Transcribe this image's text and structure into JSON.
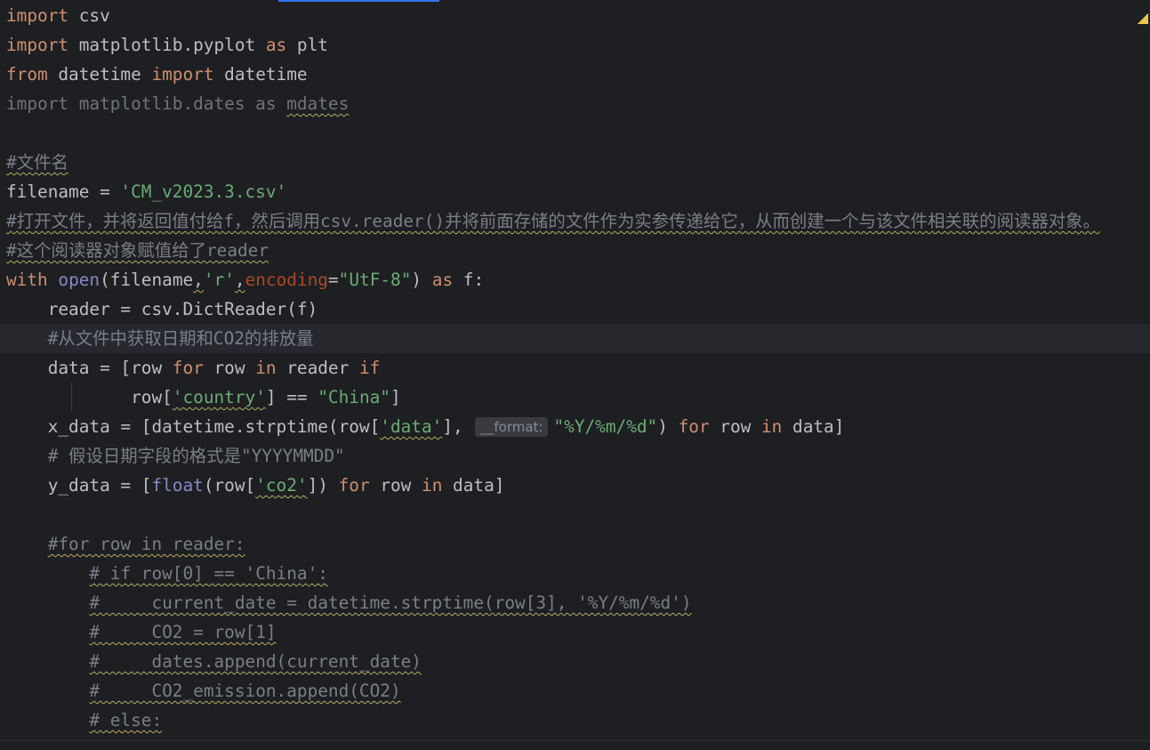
{
  "editor": {
    "language": "python",
    "current_line_index": 11,
    "inspection_widget_icon": "warning-triangle-icon",
    "parameter_hint": "__format:",
    "colors": {
      "background": "#1e1f22",
      "keyword": "#cf8e6d",
      "string": "#6aab73",
      "builtin": "#8888c6",
      "parameter": "#aa4926",
      "comment": "#7a7e85",
      "accent": "#3574f0",
      "warning_underline": "#b3ae60"
    }
  },
  "lines": [
    [
      {
        "t": "import",
        "c": "kw"
      },
      {
        "t": " csv"
      }
    ],
    [
      {
        "t": "import",
        "c": "kw"
      },
      {
        "t": " matplotlib.pyplot "
      },
      {
        "t": "as",
        "c": "kw"
      },
      {
        "t": " plt"
      }
    ],
    [
      {
        "t": "from",
        "c": "kw"
      },
      {
        "t": " datetime "
      },
      {
        "t": "import",
        "c": "kw"
      },
      {
        "t": " datetime"
      }
    ],
    [
      {
        "t": "import matplotlib.dates as ",
        "c": "unused"
      },
      {
        "t": "mdates",
        "c": "unused wavy"
      }
    ],
    [],
    [
      {
        "t": "#文件名",
        "c": "cmt wavy"
      }
    ],
    [
      {
        "t": "filename = "
      },
      {
        "t": "'CM_v2023.3.csv'",
        "c": "str"
      }
    ],
    [
      {
        "t": "#打开文件，并将返回值付给f，然后调用csv.reader()并将前面存储的文件作为实参传递给它，从而创建一个与该文件相关联的阅读器对象。",
        "c": "cmt wavy"
      }
    ],
    [
      {
        "t": "#这个阅读器对象赋值给了reader",
        "c": "cmt wavy"
      }
    ],
    [
      {
        "t": "with",
        "c": "kw"
      },
      {
        "t": " "
      },
      {
        "t": "open",
        "c": "bi"
      },
      {
        "t": "(filename"
      },
      {
        "t": ",",
        "c": "wavy"
      },
      {
        "t": "'r'",
        "c": "str"
      },
      {
        "t": ",",
        "c": "wavy"
      },
      {
        "t": "encoding",
        "c": "par"
      },
      {
        "t": "="
      },
      {
        "t": "\"UtF-8\"",
        "c": "str"
      },
      {
        "t": ") "
      },
      {
        "t": "as",
        "c": "kw"
      },
      {
        "t": " f:"
      }
    ],
    [
      {
        "t": "    reader = csv.DictReader(f)"
      }
    ],
    [
      {
        "t": "    "
      },
      {
        "t": "#从文件中获取日期和CO2的排放量",
        "c": "cmt"
      }
    ],
    [
      {
        "t": "    data = [row "
      },
      {
        "t": "for",
        "c": "kw"
      },
      {
        "t": " row "
      },
      {
        "t": "in",
        "c": "kw"
      },
      {
        "t": " reader "
      },
      {
        "t": "if",
        "c": "kw"
      }
    ],
    [
      {
        "t": "            row["
      },
      {
        "t": "'country'",
        "c": "str wavy"
      },
      {
        "t": "] == "
      },
      {
        "t": "\"China\"",
        "c": "str"
      },
      {
        "t": "]"
      }
    ],
    [
      {
        "t": "    x_data = [datetime.strptime(row["
      },
      {
        "t": "'data'",
        "c": "str wavy"
      },
      {
        "t": "], "
      },
      {
        "hint": true
      },
      {
        "t": "\"%Y/%m/%d\"",
        "c": "str"
      },
      {
        "t": ") "
      },
      {
        "t": "for",
        "c": "kw"
      },
      {
        "t": " row "
      },
      {
        "t": "in",
        "c": "kw"
      },
      {
        "t": " data]"
      }
    ],
    [
      {
        "t": "    "
      },
      {
        "t": "# 假设日期字段的格式是\"YYYYMMDD\"",
        "c": "cmt"
      }
    ],
    [
      {
        "t": "    y_data = ["
      },
      {
        "t": "float",
        "c": "bi"
      },
      {
        "t": "(row["
      },
      {
        "t": "'co2'",
        "c": "str wavy"
      },
      {
        "t": "]) "
      },
      {
        "t": "for",
        "c": "kw"
      },
      {
        "t": " row "
      },
      {
        "t": "in",
        "c": "kw"
      },
      {
        "t": " data]"
      }
    ],
    [],
    [
      {
        "t": "    "
      },
      {
        "t": "#for row in reader:",
        "c": "cmt wavy"
      }
    ],
    [
      {
        "t": "        "
      },
      {
        "t": "# if row[0] == 'China':",
        "c": "cmt wavy"
      }
    ],
    [
      {
        "t": "        "
      },
      {
        "t": "#     current_date = datetime.strptime(row[3], '%Y/%m/%d')",
        "c": "cmt wavy"
      }
    ],
    [
      {
        "t": "        "
      },
      {
        "t": "#     CO2 = row[1]",
        "c": "cmt wavy"
      }
    ],
    [
      {
        "t": "        "
      },
      {
        "t": "#     dates.append(current_date)",
        "c": "cmt wavy"
      }
    ],
    [
      {
        "t": "        "
      },
      {
        "t": "#     CO2_emission.append(CO2)",
        "c": "cmt wavy"
      }
    ],
    [
      {
        "t": "        "
      },
      {
        "t": "# else:",
        "c": "cmt wavy"
      }
    ]
  ]
}
